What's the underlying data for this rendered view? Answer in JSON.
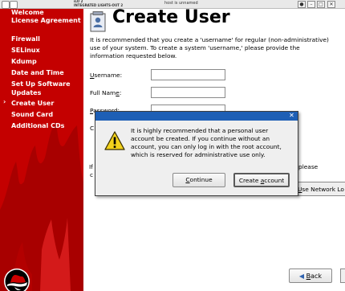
{
  "console": {
    "product_line1": "iLO 2",
    "product_line2": "INTEGRATED LIGHTS-OUT 2",
    "hostname": "host is unnamed",
    "window_buttons": [
      "●",
      "–",
      "□",
      "✕"
    ]
  },
  "sidebar": {
    "current_indicator": "›",
    "items": [
      {
        "label": "Welcome"
      },
      {
        "label": "License Agreement"
      },
      {
        "label": "Firewall"
      },
      {
        "label": "SELinux"
      },
      {
        "label": "Kdump"
      },
      {
        "label": "Date and Time"
      },
      {
        "label": "Set Up Software Updates"
      },
      {
        "label": "Create User",
        "current": true
      },
      {
        "label": "Sound Card"
      },
      {
        "label": "Additional CDs"
      }
    ]
  },
  "main": {
    "title": "Create User",
    "intro": "It is recommended that you create a 'username' for regular (non-administrative) use of your system. To create a system 'username,' please provide the information requested below.",
    "fields": [
      {
        "mnemonic": "U",
        "rest": "sername:",
        "value": ""
      },
      {
        "prefix": "Full Nam",
        "mnemonic": "e",
        "rest": ":",
        "value": ""
      },
      {
        "mnemonic": "P",
        "rest": "assword:",
        "value": ""
      }
    ],
    "fragment_c1": "C",
    "fragment_i": "If",
    "fragment_c2": "c",
    "fragment_please": "please",
    "network_button_mnemonic": "U",
    "network_button_rest": "se Network Lo",
    "back_button_mnemonic": "B",
    "back_button_rest": "ack"
  },
  "dialog": {
    "icon": "warning-icon",
    "message": "It is highly recommended that a personal user account be created.  If you continue without an account, you can only log in with the root account, which is reserved for administrative use only.",
    "continue_mnemonic": "C",
    "continue_rest": "ontinue",
    "create_prefix": "Create ",
    "create_mnemonic": "a",
    "create_rest": "ccount",
    "close_glyph": "✕"
  },
  "colors": {
    "sidebar_red": "#c40000",
    "dialog_titlebar": "#1e5fb5"
  }
}
